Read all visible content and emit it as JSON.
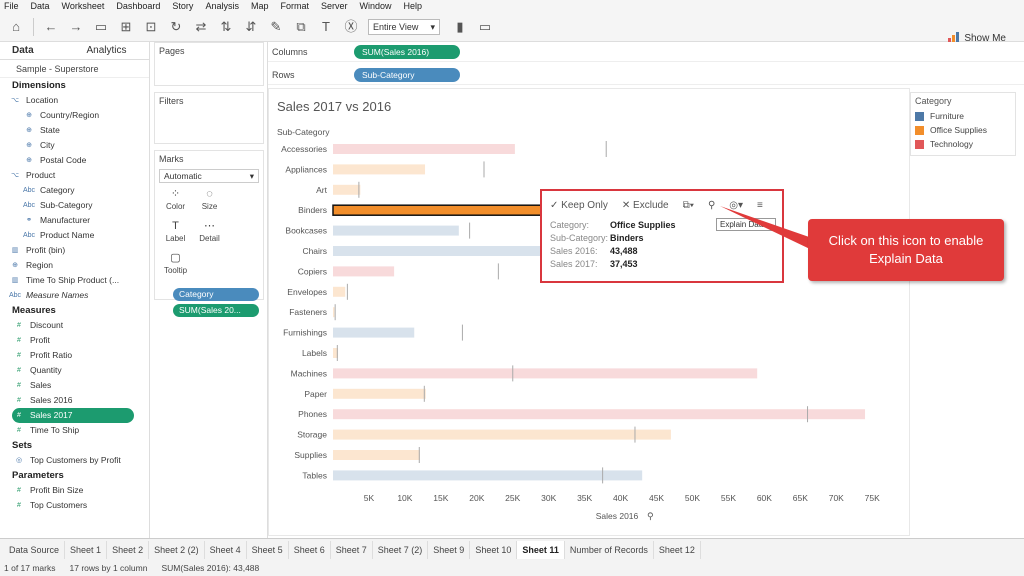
{
  "menu": [
    "File",
    "Data",
    "Worksheet",
    "Dashboard",
    "Story",
    "Analysis",
    "Map",
    "Format",
    "Server",
    "Window",
    "Help"
  ],
  "toolbar": {
    "view_select": "Entire View",
    "show_me": "Show Me"
  },
  "left_pane": {
    "tabs": [
      "Data",
      "Analytics"
    ],
    "source": "Sample - Superstore",
    "dimensions_label": "Dimensions",
    "dimensions": [
      {
        "name": "Location",
        "icon": "hierarchy-icon"
      },
      {
        "name": "Country/Region",
        "icon": "globe-icon"
      },
      {
        "name": "State",
        "icon": "globe-icon"
      },
      {
        "name": "City",
        "icon": "globe-icon"
      },
      {
        "name": "Postal Code",
        "icon": "globe-icon"
      },
      {
        "name": "Product",
        "icon": "hierarchy-icon"
      },
      {
        "name": "Category",
        "icon": "abc-icon"
      },
      {
        "name": "Sub-Category",
        "icon": "abc-icon"
      },
      {
        "name": "Manufacturer",
        "icon": "link-icon"
      },
      {
        "name": "Product Name",
        "icon": "abc-icon"
      },
      {
        "name": "Profit (bin)",
        "icon": "bin-icon"
      },
      {
        "name": "Region",
        "icon": "globe-icon"
      },
      {
        "name": "Time To Ship Product (...",
        "icon": "bin-icon"
      },
      {
        "name": "Measure Names",
        "icon": "abc-icon"
      }
    ],
    "measures_label": "Measures",
    "measures": [
      "Discount",
      "Profit",
      "Profit Ratio",
      "Quantity",
      "Sales",
      "Sales 2016",
      "Sales 2017",
      "Time To Ship"
    ],
    "sets_label": "Sets",
    "sets": [
      "Top Customers by Profit"
    ],
    "parameters_label": "Parameters",
    "parameters": [
      "Profit Bin Size",
      "Top Customers"
    ]
  },
  "cards": {
    "pages": "Pages",
    "filters": "Filters",
    "marks": "Marks",
    "mark_type": "Automatic",
    "buttons": [
      {
        "label": "Color",
        "icon": "color-icon"
      },
      {
        "label": "Size",
        "icon": "size-icon"
      },
      {
        "label": "Label",
        "icon": "label-icon"
      },
      {
        "label": "Detail",
        "icon": "detail-icon"
      },
      {
        "label": "Tooltip",
        "icon": "tooltip-icon"
      }
    ],
    "pills": [
      "Category",
      "SUM(Sales 20..."
    ]
  },
  "shelves": {
    "columns_label": "Columns",
    "columns_pill": "SUM(Sales 2016)",
    "rows_label": "Rows",
    "rows_pill": "Sub-Category"
  },
  "view": {
    "title": "Sales 2017 vs 2016"
  },
  "chart_data": {
    "type": "bar",
    "title": "Sales 2017 vs 2016",
    "xlabel": "Sales 2016",
    "ylabel": "Sub-Category",
    "xlim": [
      0,
      79000
    ],
    "xticks": [
      "5K",
      "10K",
      "15K",
      "20K",
      "25K",
      "30K",
      "35K",
      "40K",
      "45K",
      "50K",
      "55K",
      "60K",
      "65K",
      "70K",
      "75K"
    ],
    "categories": [
      "Accessories",
      "Appliances",
      "Art",
      "Binders",
      "Bookcases",
      "Chairs",
      "Copiers",
      "Envelopes",
      "Fasteners",
      "Furnishings",
      "Labels",
      "Machines",
      "Paper",
      "Phones",
      "Storage",
      "Supplies",
      "Tables"
    ],
    "sales_2016": [
      25300,
      12800,
      3800,
      43488,
      17500,
      62000,
      8500,
      1700,
      200,
      11300,
      700,
      59000,
      12900,
      74000,
      47000,
      12100,
      43000
    ],
    "sales_2017": [
      38000,
      21000,
      3600,
      37453,
      19000,
      60000,
      23000,
      2000,
      300,
      18000,
      600,
      25000,
      12700,
      66000,
      42000,
      12000,
      37500
    ],
    "category_of": [
      "Technology",
      "Office Supplies",
      "Office Supplies",
      "Office Supplies",
      "Furniture",
      "Furniture",
      "Technology",
      "Office Supplies",
      "Office Supplies",
      "Furniture",
      "Office Supplies",
      "Technology",
      "Office Supplies",
      "Technology",
      "Office Supplies",
      "Office Supplies",
      "Furniture"
    ],
    "highlight": "Binders",
    "grid": false
  },
  "legend": {
    "title": "Category",
    "items": [
      {
        "name": "Furniture",
        "color": "#4e79a7"
      },
      {
        "name": "Office Supplies",
        "color": "#f28e2b"
      },
      {
        "name": "Technology",
        "color": "#e15759"
      }
    ]
  },
  "tooltip": {
    "keep_only": "Keep Only",
    "exclude": "Exclude",
    "hint": "Explain Data...",
    "rows": [
      {
        "key": "Category:",
        "value": "Office Supplies"
      },
      {
        "key": "Sub-Category:",
        "value": "Binders"
      },
      {
        "key": "Sales 2016:",
        "value": "43,488"
      },
      {
        "key": "Sales 2017:",
        "value": "37,453"
      }
    ]
  },
  "callout": "Click on this icon to enable Explain Data",
  "sheet_tabs": [
    "Data Source",
    "Sheet 1",
    "Sheet 2",
    "Sheet 2 (2)",
    "Sheet 4",
    "Sheet 5",
    "Sheet 6",
    "Sheet 7",
    "Sheet 7 (2)",
    "Sheet 9",
    "Sheet 10",
    "Sheet 11",
    "Number of Records",
    "Sheet 12"
  ],
  "active_sheet": "Sheet 11",
  "status": [
    "1 of 17 marks",
    "17 rows by 1 column",
    "SUM(Sales 2016): 43,488"
  ]
}
